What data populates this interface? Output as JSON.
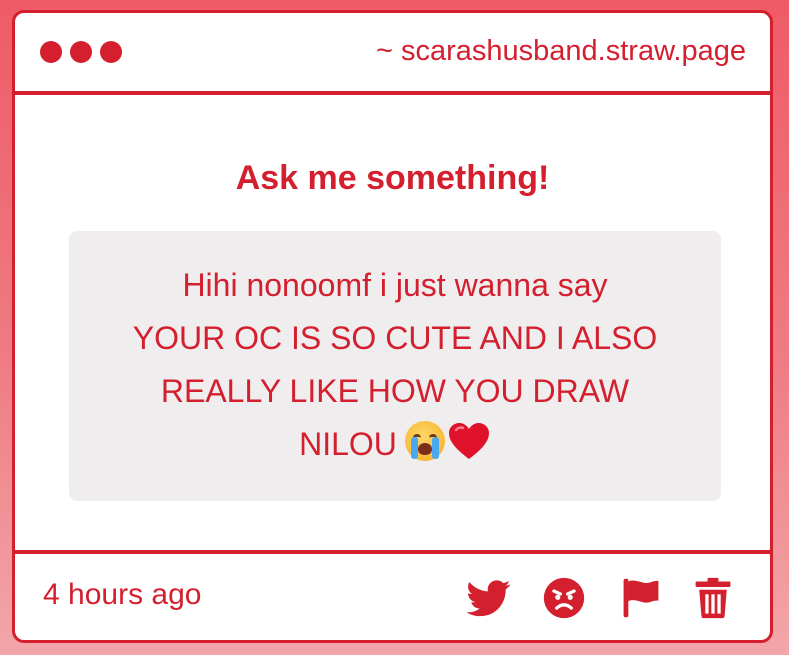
{
  "window": {
    "url": "~ scarashusband.straw.page"
  },
  "prompt": {
    "title": "Ask me something!"
  },
  "message": {
    "lines": [
      "Hihi nonoomf i just wanna say",
      "YOUR OC IS SO CUTE AND I ALSO",
      "REALLY LIKE HOW YOU DRAW",
      "NILOU"
    ],
    "emojis": [
      "loudly-crying-face-emoji",
      "red-heart-emoji"
    ]
  },
  "footer": {
    "timestamp": "4 hours ago",
    "actions": [
      "twitter-icon",
      "angry-face-icon",
      "flag-icon",
      "trash-icon"
    ]
  },
  "colors": {
    "accent": "#d31f2e",
    "message_background": "#efedee",
    "page_background_top": "#ef5b66",
    "page_background_bottom": "#f2a6a9"
  }
}
